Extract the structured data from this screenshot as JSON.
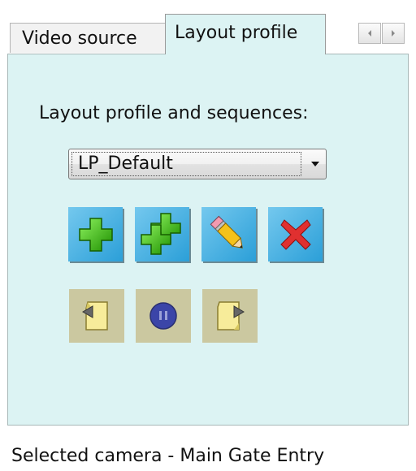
{
  "tabs": {
    "video_source": "Video source",
    "layout_profile": "Layout profile"
  },
  "panel": {
    "heading": "Layout profile and sequences:",
    "profile_select": {
      "value": "LP_Default"
    },
    "buttons": [
      {
        "name": "add",
        "icon": "green-plus-icon"
      },
      {
        "name": "add-multiple",
        "icon": "double-green-plus-icon"
      },
      {
        "name": "edit",
        "icon": "pencil-icon"
      },
      {
        "name": "delete",
        "icon": "red-x-icon"
      }
    ],
    "sequence_buttons": [
      {
        "name": "previous",
        "icon": "page-back-icon"
      },
      {
        "name": "pause",
        "icon": "pause-circle-icon"
      },
      {
        "name": "next",
        "icon": "page-forward-icon"
      }
    ]
  },
  "status": {
    "text": "Selected camera - Main Gate Entry"
  },
  "colors": {
    "panel_bg": "#dcf3f3",
    "button_blue": "#2b9fd8",
    "button_tan": "#cbc8a0",
    "delete_red": "#e03030",
    "add_green": "#34b000"
  }
}
